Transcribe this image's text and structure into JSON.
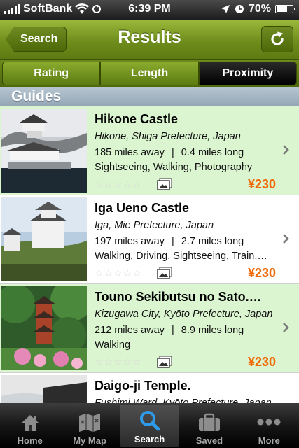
{
  "status_bar": {
    "carrier": "SoftBank",
    "time": "6:39 PM",
    "battery": "70%",
    "battery_level": 0.7
  },
  "nav": {
    "back_label": "Search",
    "title": "Results",
    "refresh_icon": "refresh-icon"
  },
  "segments": [
    {
      "label": "Rating",
      "active": false
    },
    {
      "label": "Length",
      "active": false
    },
    {
      "label": "Proximity",
      "active": true
    }
  ],
  "section": {
    "title": "Guides"
  },
  "guides": [
    {
      "title": "Hikone Castle",
      "location": "Hikone, Shiga Prefecture, Japan",
      "distance": "185 miles away",
      "length": "0.4 miles long",
      "tags": "Sightseeing, Walking, Photography",
      "price": "¥230",
      "rating": 0
    },
    {
      "title": "Iga Ueno Castle",
      "location": "Iga, Mie Prefecture, Japan",
      "distance": "197 miles away",
      "length": "2.7 miles long",
      "tags": "Walking, Driving, Sightseeing, Train,…",
      "price": "¥230",
      "rating": 0
    },
    {
      "title": "Touno Sekibutsu no Sato.…",
      "location": "Kizugawa City, Kyōto Prefecture, Japan",
      "distance": "212 miles away",
      "length": "8.9 miles long",
      "tags": "Walking",
      "price": "¥230",
      "rating": 0
    },
    {
      "title": "Daigo-ji Temple.",
      "location": "Fushimi Ward, Kyōto Prefecture, Japan",
      "distance": "",
      "length": "",
      "tags": "",
      "price": "",
      "rating": 0
    }
  ],
  "separator": "|",
  "tabs": [
    {
      "label": "Home",
      "icon": "home-icon",
      "active": false
    },
    {
      "label": "My Map",
      "icon": "map-icon",
      "active": false
    },
    {
      "label": "Search",
      "icon": "search-icon",
      "active": true
    },
    {
      "label": "Saved",
      "icon": "briefcase-icon",
      "active": false
    },
    {
      "label": "More",
      "icon": "more-icon",
      "active": false
    }
  ],
  "colors": {
    "accent": "#6f8d1c",
    "price": "#f06a08",
    "highlight_row": "#daf5cf"
  }
}
